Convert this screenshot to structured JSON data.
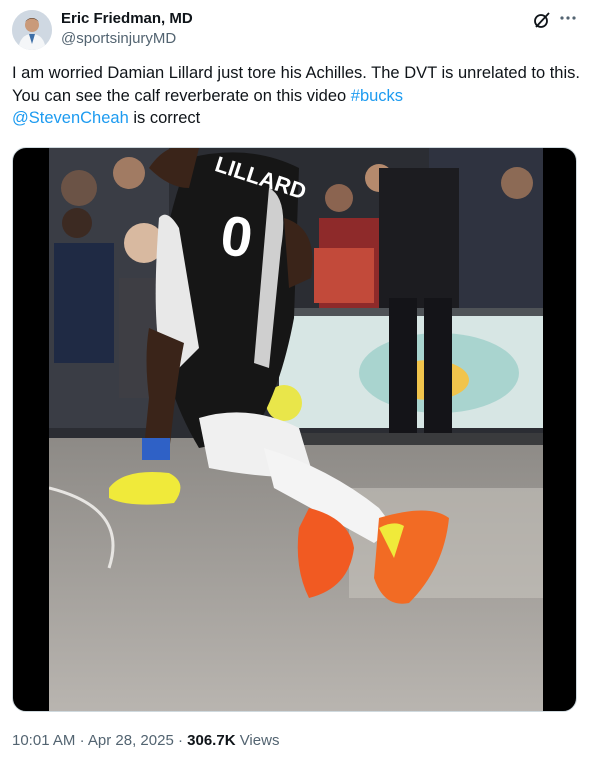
{
  "author": {
    "name": "Eric Friedman, MD",
    "handle": "@sportsinjuryMD"
  },
  "tweet": {
    "text_main": "I am worried Damian Lillard just tore his Achilles. The DVT is unrelated to this. You can see the calf reverberate on this video ",
    "hashtag": "#bucks",
    "mention": "@StevenCheah",
    "text_tail": " is correct"
  },
  "media": {
    "jersey_name": "LILLARD",
    "jersey_number": "0"
  },
  "meta": {
    "time": "10:01 AM",
    "date": "Apr 28, 2025",
    "separator": "·",
    "views_count": "306.7K",
    "views_label": "Views"
  },
  "icons": {
    "grok": "grok-icon",
    "more": "more-icon",
    "download": "download-icon"
  }
}
